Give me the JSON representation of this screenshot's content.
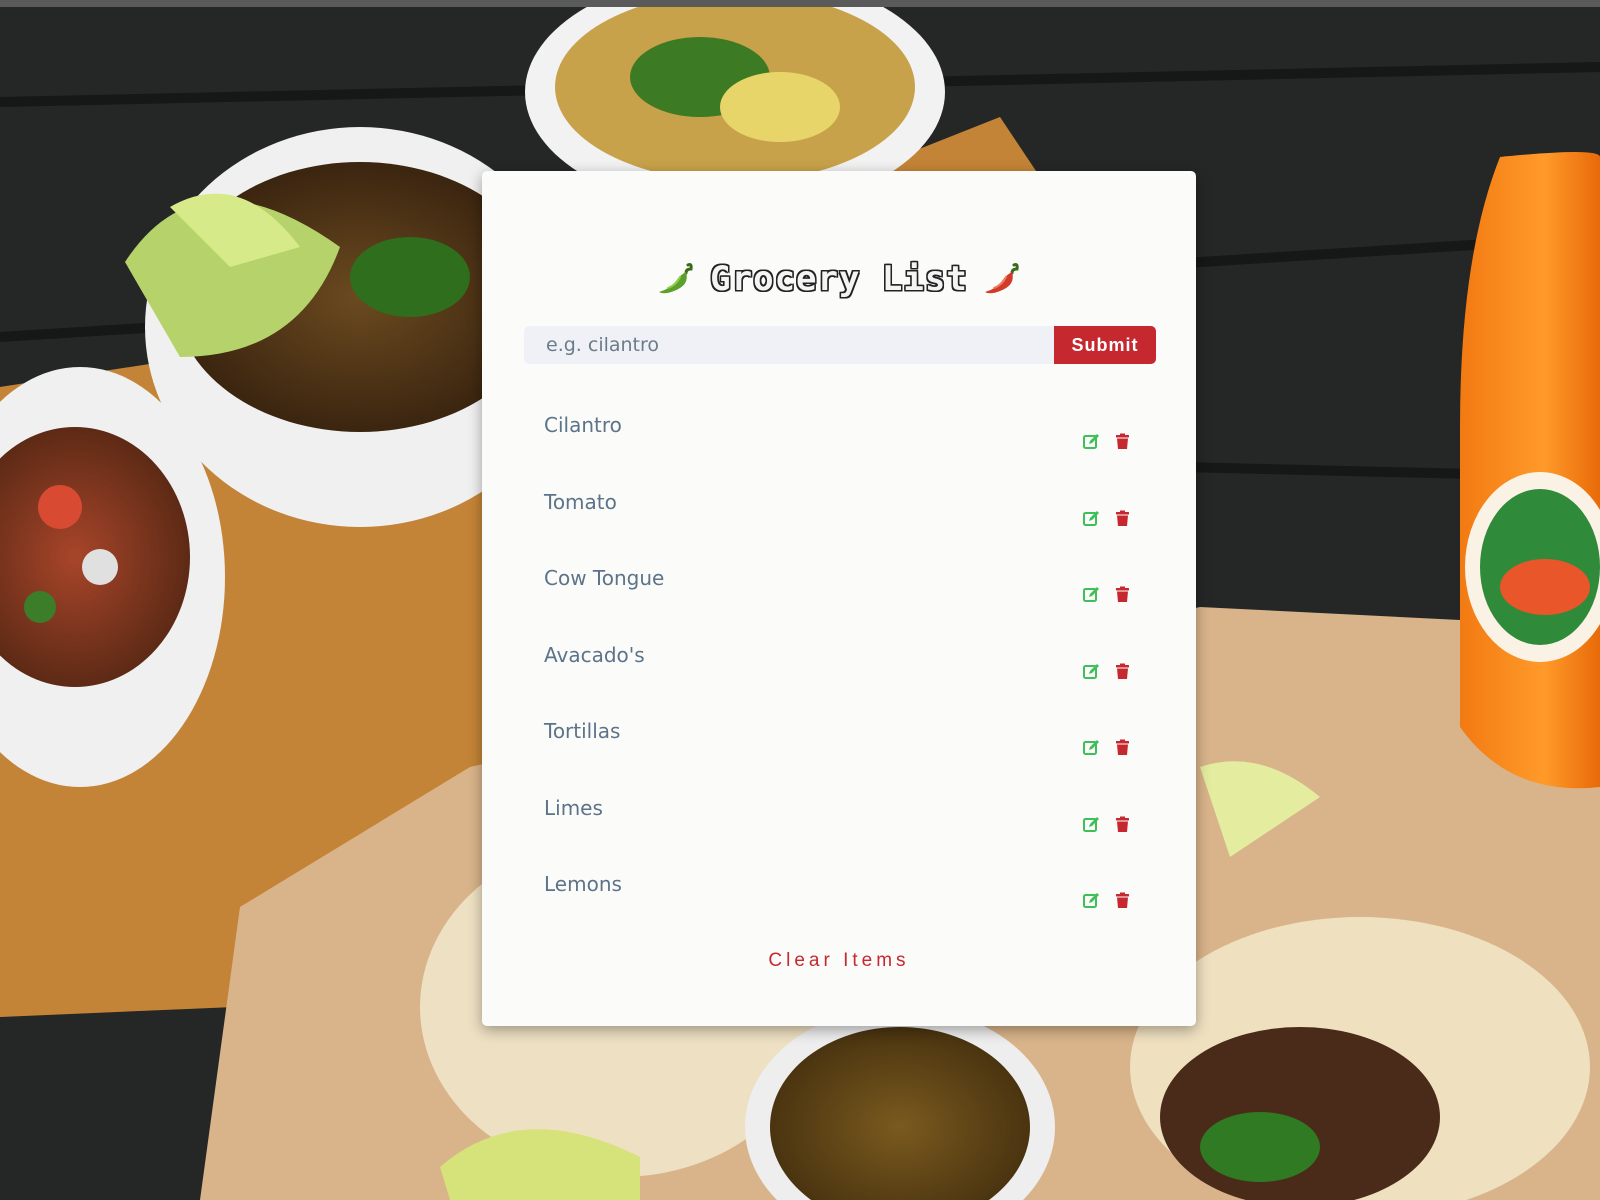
{
  "app": {
    "title": "Grocery List"
  },
  "form": {
    "placeholder": "e.g. cilantro",
    "value": "",
    "submit_label": "Submit"
  },
  "items": [
    {
      "label": "Cilantro"
    },
    {
      "label": "Tomato"
    },
    {
      "label": "Cow Tongue"
    },
    {
      "label": "Avacado's"
    },
    {
      "label": "Tortillas"
    },
    {
      "label": "Limes"
    },
    {
      "label": "Lemons"
    }
  ],
  "clear_label": "Clear Items",
  "icons": {
    "edit": "edit-icon",
    "delete": "trash-icon",
    "title_left": "green-chili-pepper-icon",
    "title_right": "red-chili-pepper-icon"
  },
  "colors": {
    "accent_red": "#c5282f",
    "edit_green": "#3fbf5a",
    "item_text": "#5c7389",
    "card_bg": "#fbfcf9",
    "input_bg": "#eff1f6"
  }
}
